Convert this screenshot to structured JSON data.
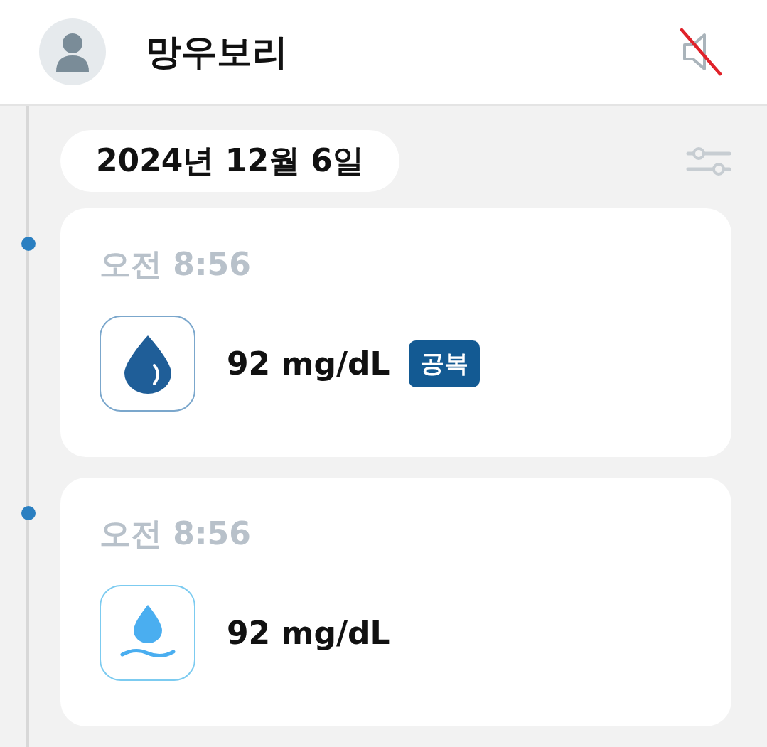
{
  "header": {
    "title": "망우보리",
    "sound_muted": true
  },
  "date": "2024년 12월 6일",
  "entries": [
    {
      "time": "오전 8:56",
      "kind": "drop",
      "value": "92 mg/dL",
      "tag": "공복"
    },
    {
      "time": "오전 8:56",
      "kind": "wave",
      "value": "92 mg/dL"
    }
  ]
}
